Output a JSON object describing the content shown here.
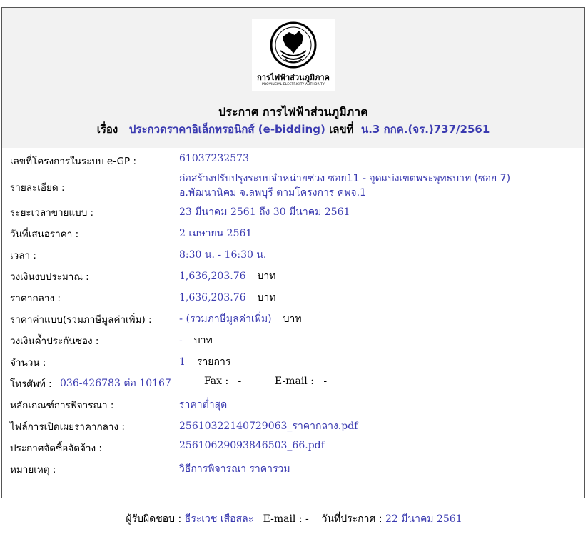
{
  "header": {
    "org_th": "การไฟฟ้าส่วนภูมิภาค",
    "org_en": "PROVINCIAL ELECTRICITY AUTHORITY",
    "announcement": "ประกาศ การไฟฟ้าส่วนภูมิภาค",
    "subject_label": "เรื่อง",
    "subject_title": "ประกวดราคาอิเล็กทรอนิกส์ (e-bidding)",
    "number_label": "เลขที่",
    "number_value": "น.3 กกค.(จร.)737/2561"
  },
  "fields": {
    "project_no": {
      "label": "เลขที่โครงการในระบบ e-GP :",
      "value": "61037232573"
    },
    "details": {
      "label": "รายละเอียด :",
      "line1": "ก่อสร้างปรับปรุงระบบจำหน่ายช่วง ซอย11 - จุดแบ่งเขตพระพุทธบาท (ซอย 7)",
      "line2": "อ.พัฒนานิคม จ.ลพบุรี ตามโครงการ คพจ.1"
    },
    "sale_period": {
      "label": "ระยะเวลาขายแบบ :",
      "value": "23 มีนาคม 2561 ถึง 30 มีนาคม 2561"
    },
    "bid_date": {
      "label": "วันที่เสนอราคา :",
      "value": "2 เมษายน 2561"
    },
    "time": {
      "label": "เวลา :",
      "value": "8:30 น. - 16:30 น."
    },
    "budget": {
      "label": "วงเงินงบประมาณ :",
      "value": "1,636,203.76",
      "unit": "บาท"
    },
    "median_price": {
      "label": "ราคากลาง :",
      "value": "1,636,203.76",
      "unit": "บาท"
    },
    "doc_price": {
      "label": "ราคาค่าแบบ(รวมภาษีมูลค่าเพิ่ม) :",
      "value": "- (รวมภาษีมูลค่าเพิ่ม)",
      "unit": "บาท"
    },
    "guarantee": {
      "label": "วงเงินค้ำประกันซอง :",
      "value": "-",
      "unit": "บาท"
    },
    "quantity": {
      "label": "จำนวน :",
      "value": "1",
      "unit": "รายการ"
    },
    "phone": {
      "label": "โทรศัพท์ :",
      "value": "036-426783 ต่อ 10167",
      "fax_label": "Fax :",
      "fax_value": "-",
      "email_label": "E-mail :",
      "email_value": "-"
    },
    "criteria": {
      "label": "หลักเกณฑ์การพิจารณา :",
      "value": "ราคาต่ำสุด"
    },
    "price_file": {
      "label": "ไฟล์การเปิดเผยราคากลาง :",
      "value": "25610322140729063_ราคากลาง.pdf"
    },
    "procure_notice": {
      "label": "ประกาศจัดซื้อจัดจ้าง :",
      "value": "25610629093846503_66.pdf"
    },
    "remark": {
      "label": "หมายเหตุ :",
      "value": "วิธีการพิจารณา ราคารวม"
    }
  },
  "footer": {
    "responsible_label": "ผู้รับผิดชอบ :",
    "responsible_name": "ธีระเวช เสือสละ",
    "email_label": "E-mail : -",
    "date_label": "วันที่ประกาศ :",
    "date_value": "22 มีนาคม 2561"
  }
}
